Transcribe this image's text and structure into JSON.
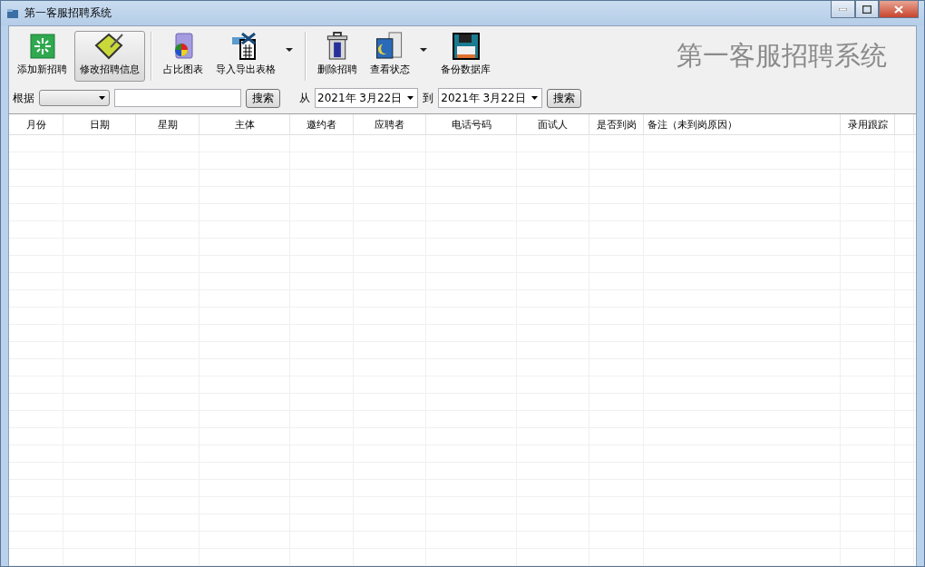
{
  "window": {
    "title": "第一客服招聘系统"
  },
  "toolbar": [
    {
      "label": "添加新招聘",
      "kind": "add",
      "selected": false,
      "dropdown": false
    },
    {
      "label": "修改招聘信息",
      "kind": "edit",
      "selected": true,
      "dropdown": false
    },
    {
      "label": "占比图表",
      "kind": "chart",
      "selected": false,
      "dropdown": false
    },
    {
      "label": "导入导出表格",
      "kind": "excel",
      "selected": false,
      "dropdown": true
    },
    {
      "label": "删除招聘",
      "kind": "trash",
      "selected": false,
      "dropdown": false
    },
    {
      "label": "查看状态",
      "kind": "status",
      "selected": false,
      "dropdown": true
    },
    {
      "label": "备份数据库",
      "kind": "disk",
      "selected": false,
      "dropdown": false
    }
  ],
  "banner": "第一客服招聘系统",
  "filter": {
    "label": "根据",
    "search_button": "搜索",
    "from_label": "从",
    "from_date": "2021年  3月22日",
    "to_label": "到",
    "to_date": "2021年  3月22日",
    "date_search_button": "搜索"
  },
  "table": {
    "columns": [
      "月份",
      "日期",
      "星期",
      "主体",
      "邀约者",
      "应聘者",
      "电话号码",
      "面试人",
      "是否到岗",
      "备注（未到岗原因）",
      "录用跟踪"
    ]
  }
}
